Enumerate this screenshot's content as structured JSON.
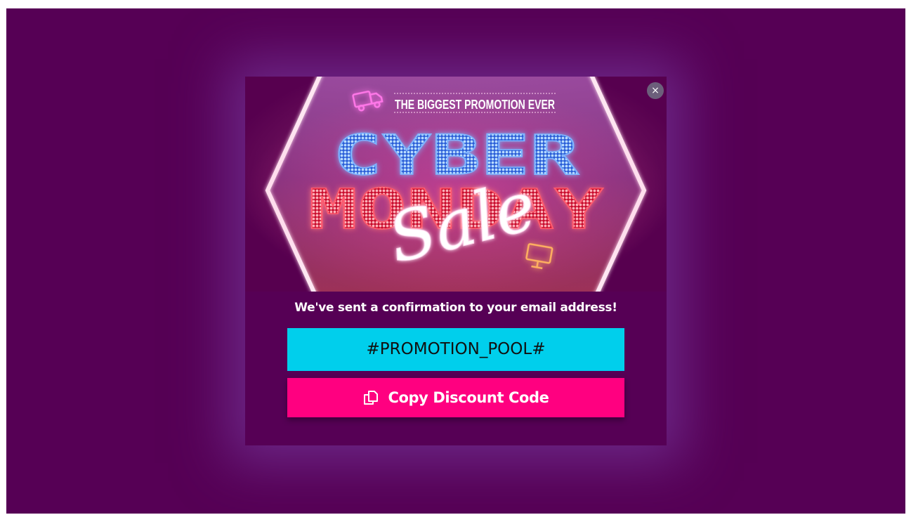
{
  "hero": {
    "tagline": "THE BIGGEST PROMOTION EVER",
    "title_line1": "CYBER",
    "title_line2": "MONDAY",
    "script_word": "Sale"
  },
  "close": {
    "symbol": "×"
  },
  "confirmation": {
    "message": "We've sent a confirmation to your email address!"
  },
  "discount": {
    "code": "#PROMOTION_POOL#",
    "copy_label": "Copy Discount Code"
  },
  "colors": {
    "page_background": "#560055",
    "code_box": "#00cfec",
    "copy_button": "#ff0080"
  }
}
